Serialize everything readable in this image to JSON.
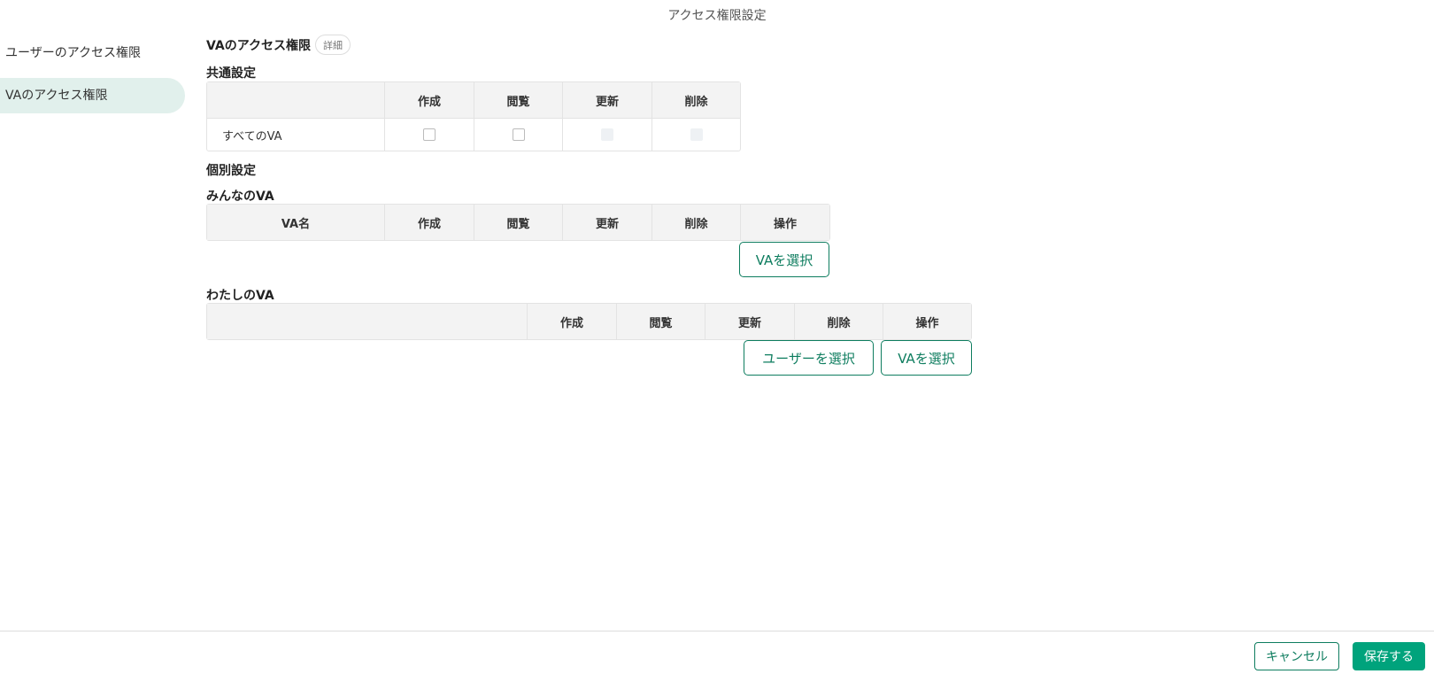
{
  "dialog": {
    "title": "アクセス権限設定"
  },
  "sidebar": {
    "items": [
      {
        "label": "ユーザーのアクセス権限"
      },
      {
        "label": "VAのアクセス権限"
      }
    ]
  },
  "main": {
    "heading": "VAのアクセス権限",
    "detail_badge": "詳細",
    "common": {
      "label": "共通設定",
      "columns": [
        "",
        "作成",
        "閲覧",
        "更新",
        "削除"
      ],
      "row_label": "すべてのVA"
    },
    "individual": {
      "label": "個別設定"
    },
    "everyone_va": {
      "label": "みんなのVA",
      "columns": [
        "VA名",
        "作成",
        "閲覧",
        "更新",
        "削除",
        "操作"
      ],
      "select_va_label": "VAを選択"
    },
    "my_va": {
      "label": "わたしのVA",
      "columns": [
        "",
        "作成",
        "閲覧",
        "更新",
        "削除",
        "操作"
      ],
      "select_user_label": "ユーザーを選択",
      "select_va_label": "VAを選択"
    }
  },
  "footer": {
    "cancel_label": "キャンセル",
    "save_label": "保存する"
  },
  "colors": {
    "accent": "#0e7d5f",
    "save": "#00a37c",
    "sidebar_active": "#e1f0ec"
  }
}
